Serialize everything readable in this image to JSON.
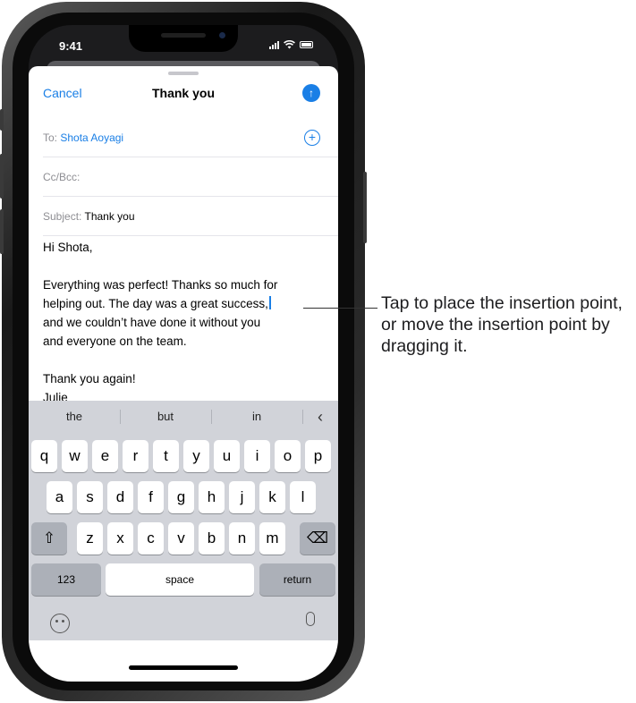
{
  "status_bar": {
    "time": "9:41"
  },
  "nav": {
    "cancel_label": "Cancel",
    "title": "Thank you",
    "send_icon": "arrow-up"
  },
  "fields": {
    "to_label": "To:",
    "to_value": "Shota Aoyagi",
    "cc_label": "Cc/Bcc:",
    "subject_label": "Subject:",
    "subject_value": "Thank you"
  },
  "body": {
    "greeting": "Hi Shota,",
    "para1_line1": "Everything was perfect! Thanks so much for",
    "para1_line2": "helping out. The day was a great success,",
    "para1_line3": "and we couldn’t have done it without you",
    "para1_line4": "and everyone on the team.",
    "closing": "Thank you again!",
    "signature": "Julie"
  },
  "keyboard": {
    "suggestions": [
      "the",
      "but",
      "in"
    ],
    "row1": [
      "q",
      "w",
      "e",
      "r",
      "t",
      "y",
      "u",
      "i",
      "o",
      "p"
    ],
    "row2": [
      "a",
      "s",
      "d",
      "f",
      "g",
      "h",
      "j",
      "k",
      "l"
    ],
    "row3": [
      "z",
      "x",
      "c",
      "v",
      "b",
      "n",
      "m"
    ],
    "numbers_label": "123",
    "space_label": "space",
    "return_label": "return"
  },
  "callout": {
    "text": "Tap to place the insertion point, or move the insertion point by dragging it."
  },
  "colors": {
    "accent": "#1a7fe6",
    "keyboard_bg": "#d1d3d9"
  }
}
